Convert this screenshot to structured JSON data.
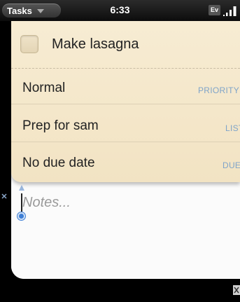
{
  "status_bar": {
    "app_title": "Tasks",
    "time": "6:33",
    "carrier_badge": "Ev"
  },
  "task": {
    "title": "Make lasagna",
    "completed": false
  },
  "rows": {
    "priority": {
      "value": "Normal",
      "label": "PRIORITY"
    },
    "list": {
      "value": "Prep for sam",
      "label": "LIST"
    },
    "due": {
      "value": "No due date",
      "label": "DUE"
    }
  },
  "notes": {
    "placeholder": "Notes..."
  },
  "icons": {
    "app_menu": "chevron-down-icon",
    "signal": "signal-strength-icon",
    "cursor_handle": "text-cursor-handle-icon",
    "corner": "close-icon"
  },
  "colors": {
    "parchment": "#f3e5c6",
    "label_blue": "#7fa4c9",
    "notes_bg": "#fbfbfb",
    "cursor_blue": "#3f7fd6"
  }
}
